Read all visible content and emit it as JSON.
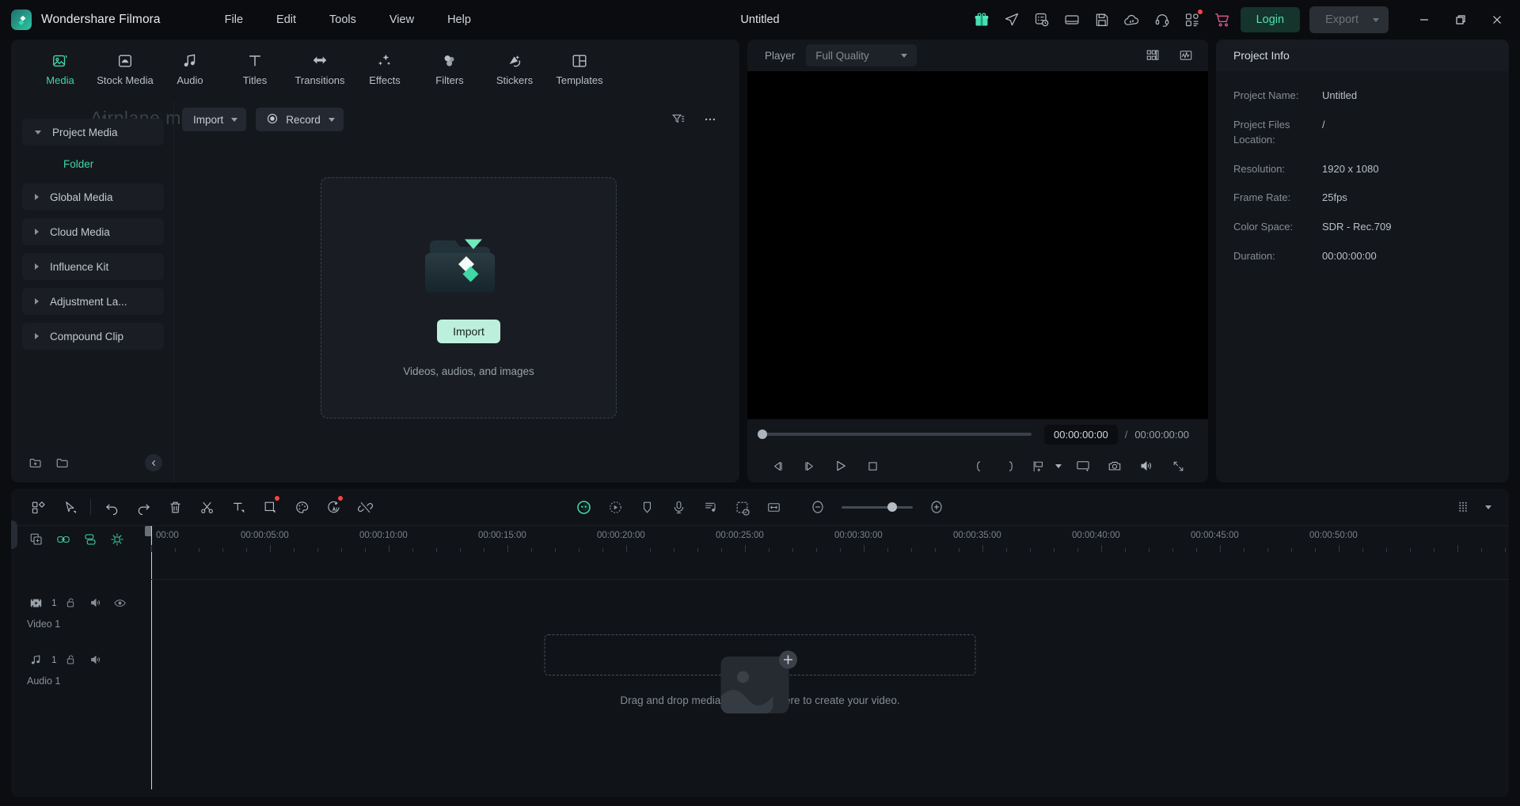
{
  "app": {
    "brand": "Wondershare Filmora",
    "document_title": "Untitled",
    "menu": [
      "File",
      "Edit",
      "Tools",
      "View",
      "Help"
    ],
    "titlebar_icons": [
      "gift-icon",
      "send-icon",
      "task-history-icon",
      "screen-icon",
      "save-icon",
      "cloud-sync-icon",
      "headset-icon",
      "apps-grid-icon",
      "cart-icon"
    ],
    "login_label": "Login",
    "export_label": "Export",
    "window_controls": [
      "minimize",
      "restore",
      "close"
    ]
  },
  "toast": {
    "text": "Airplane mode off"
  },
  "media_panel": {
    "tabs": [
      {
        "label": "Media",
        "icon": "media-icon",
        "active": true
      },
      {
        "label": "Stock Media",
        "icon": "stock-media-icon",
        "active": false
      },
      {
        "label": "Audio",
        "icon": "audio-note-icon",
        "active": false
      },
      {
        "label": "Titles",
        "icon": "titles-t-icon",
        "active": false
      },
      {
        "label": "Transitions",
        "icon": "transitions-arrows-icon",
        "active": false
      },
      {
        "label": "Effects",
        "icon": "effects-wand-icon",
        "active": false
      },
      {
        "label": "Filters",
        "icon": "filters-circles-icon",
        "active": false
      },
      {
        "label": "Stickers",
        "icon": "stickers-icon",
        "active": false
      },
      {
        "label": "Templates",
        "icon": "templates-layout-icon",
        "active": false
      }
    ],
    "sidebar": [
      {
        "label": "Project Media",
        "expanded": true
      },
      {
        "label": "Folder",
        "child": true
      },
      {
        "label": "Global Media",
        "expanded": false
      },
      {
        "label": "Cloud Media",
        "expanded": false
      },
      {
        "label": "Influence Kit",
        "expanded": false
      },
      {
        "label": "Adjustment La...",
        "expanded": false
      },
      {
        "label": "Compound Clip",
        "expanded": false
      }
    ],
    "sidebar_bottom_icons": [
      "new-folder-icon",
      "folder-icon",
      "collapse-panel-icon"
    ],
    "toolbar": {
      "import_label": "Import",
      "record_label": "Record",
      "filter_icon": "filter-sort-icon",
      "more_icon": "more-dots-icon"
    },
    "dropzone": {
      "cta_label": "Import",
      "subtitle": "Videos, audios, and images"
    }
  },
  "player": {
    "title": "Player",
    "quality": "Full Quality",
    "header_icons": [
      "layout-grid-icon",
      "scope-waveform-icon"
    ],
    "current_time": "00:00:00:00",
    "separator": "/",
    "total_time": "00:00:00:00",
    "controls": [
      "prev-frame-icon",
      "next-frame-icon",
      "play-icon",
      "stop-icon"
    ],
    "controls_right": [
      "mark-in-icon",
      "mark-out-icon",
      "add-marker-icon",
      "marker-chevron-icon",
      "pip-screen-icon",
      "snapshot-camera-icon",
      "volume-icon",
      "fullscreen-icon"
    ]
  },
  "project_info": {
    "title": "Project Info",
    "rows": [
      {
        "key": "Project Name:",
        "value": "Untitled"
      },
      {
        "key": "Project Files Location:",
        "value": "/"
      },
      {
        "key": "Resolution:",
        "value": "1920 x 1080"
      },
      {
        "key": "Frame Rate:",
        "value": "25fps"
      },
      {
        "key": "Color Space:",
        "value": "SDR - Rec.709"
      },
      {
        "key": "Duration:",
        "value": "00:00:00:00"
      }
    ]
  },
  "timeline": {
    "toolbar_left_icons": [
      "apps-grid-icon",
      "select-cursor-icon",
      "undo-icon",
      "redo-icon",
      "delete-icon",
      "split-scissors-icon",
      "text-tool-icon",
      "crop-tool-icon",
      "color-palette-icon",
      "ai-tools-icon",
      "unlink-icon"
    ],
    "toolbar_center_icons": [
      "ai-mask-icon",
      "speed-ramp-icon",
      "marker-icon",
      "mic-record-icon",
      "audio-mixer-icon",
      "keyframe-panel-icon",
      "fit-timeline-icon"
    ],
    "zoom_out_icon": "zoom-out-icon",
    "zoom_in_icon": "zoom-in-icon",
    "toolbar_right_icons": [
      "track-manager-icon",
      "dropdown-chevron-icon"
    ],
    "track_head_icons": [
      "duplicate-track-icon",
      "link-icon",
      "group-icon",
      "auto-sync-icon"
    ],
    "ruler_labels": [
      "00:00",
      "00:00:05:00",
      "00:00:10:00",
      "00:00:15:00",
      "00:00:20:00",
      "00:00:25:00",
      "00:00:30:00",
      "00:00:35:00",
      "00:00:40:00",
      "00:00:45:00",
      "00:00:50:00"
    ],
    "tracks": [
      {
        "name": "Video 1",
        "number": "1",
        "icons": [
          "video-track-icon",
          "lock-icon",
          "mute-icon",
          "eye-icon"
        ]
      },
      {
        "name": "Audio 1",
        "number": "1",
        "icons": [
          "audio-track-icon",
          "lock-icon",
          "mute-icon"
        ]
      }
    ],
    "drop_text": "Drag and drop media and effects here to create your video."
  },
  "colors": {
    "accent": "#3fd8a6",
    "accent_soft": "#bdf0dc",
    "panel_bg": "#14171c",
    "window_bg": "#0b0d10",
    "badge_red": "#ff4242"
  }
}
